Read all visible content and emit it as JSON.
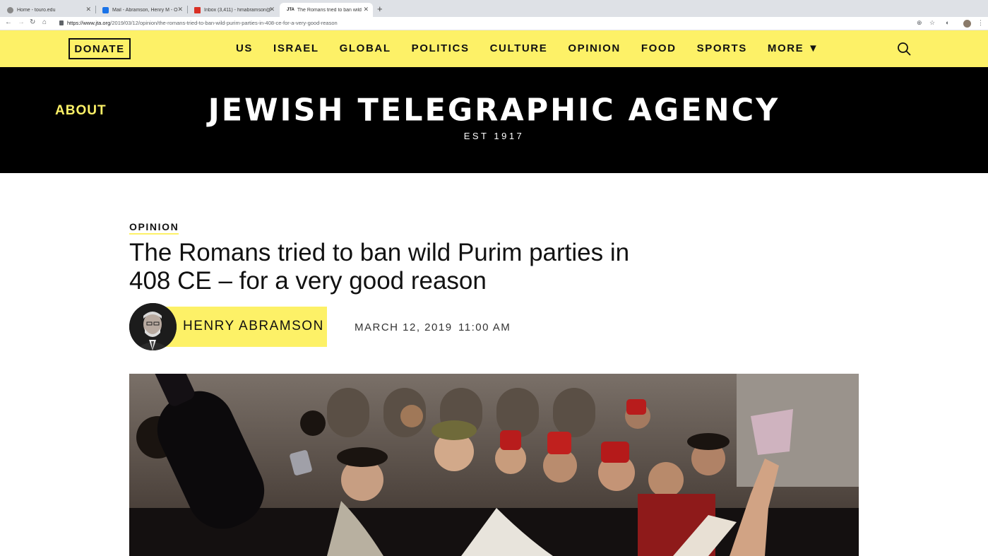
{
  "browser": {
    "tabs": [
      {
        "title": "Home - touro.edu",
        "active": false
      },
      {
        "title": "Mail - Abramson, Henry M - O",
        "active": false
      },
      {
        "title": "Inbox (3,411) - hmabramson@",
        "active": false
      },
      {
        "title": "The Romans tried to ban wild P",
        "active": true
      }
    ],
    "url_domain": "https://www.jta.org",
    "url_path": "/2019/03/12/opinion/the-romans-tried-to-ban-wild-purim-parties-in-408-ce-for-a-very-good-reason",
    "jta_favicon": "JTA"
  },
  "header": {
    "donate_label": "DONATE",
    "nav": [
      "US",
      "ISRAEL",
      "GLOBAL",
      "POLITICS",
      "CULTURE",
      "OPINION",
      "FOOD",
      "SPORTS",
      "MORE ▼"
    ],
    "search_icon": "search-icon",
    "about_label": "ABOUT",
    "brand": "JEWISH TELEGRAPHIC AGENCY",
    "est": "EST 1917"
  },
  "article": {
    "category": "OPINION",
    "headline": "The Romans tried to ban wild Purim parties in 408 CE – for a very good reason",
    "author": "HENRY ABRAMSON",
    "date": "MARCH 12, 2019",
    "time": "11:00 AM"
  },
  "colors": {
    "accent_yellow": "#fdf167",
    "masthead_black": "#000000"
  }
}
